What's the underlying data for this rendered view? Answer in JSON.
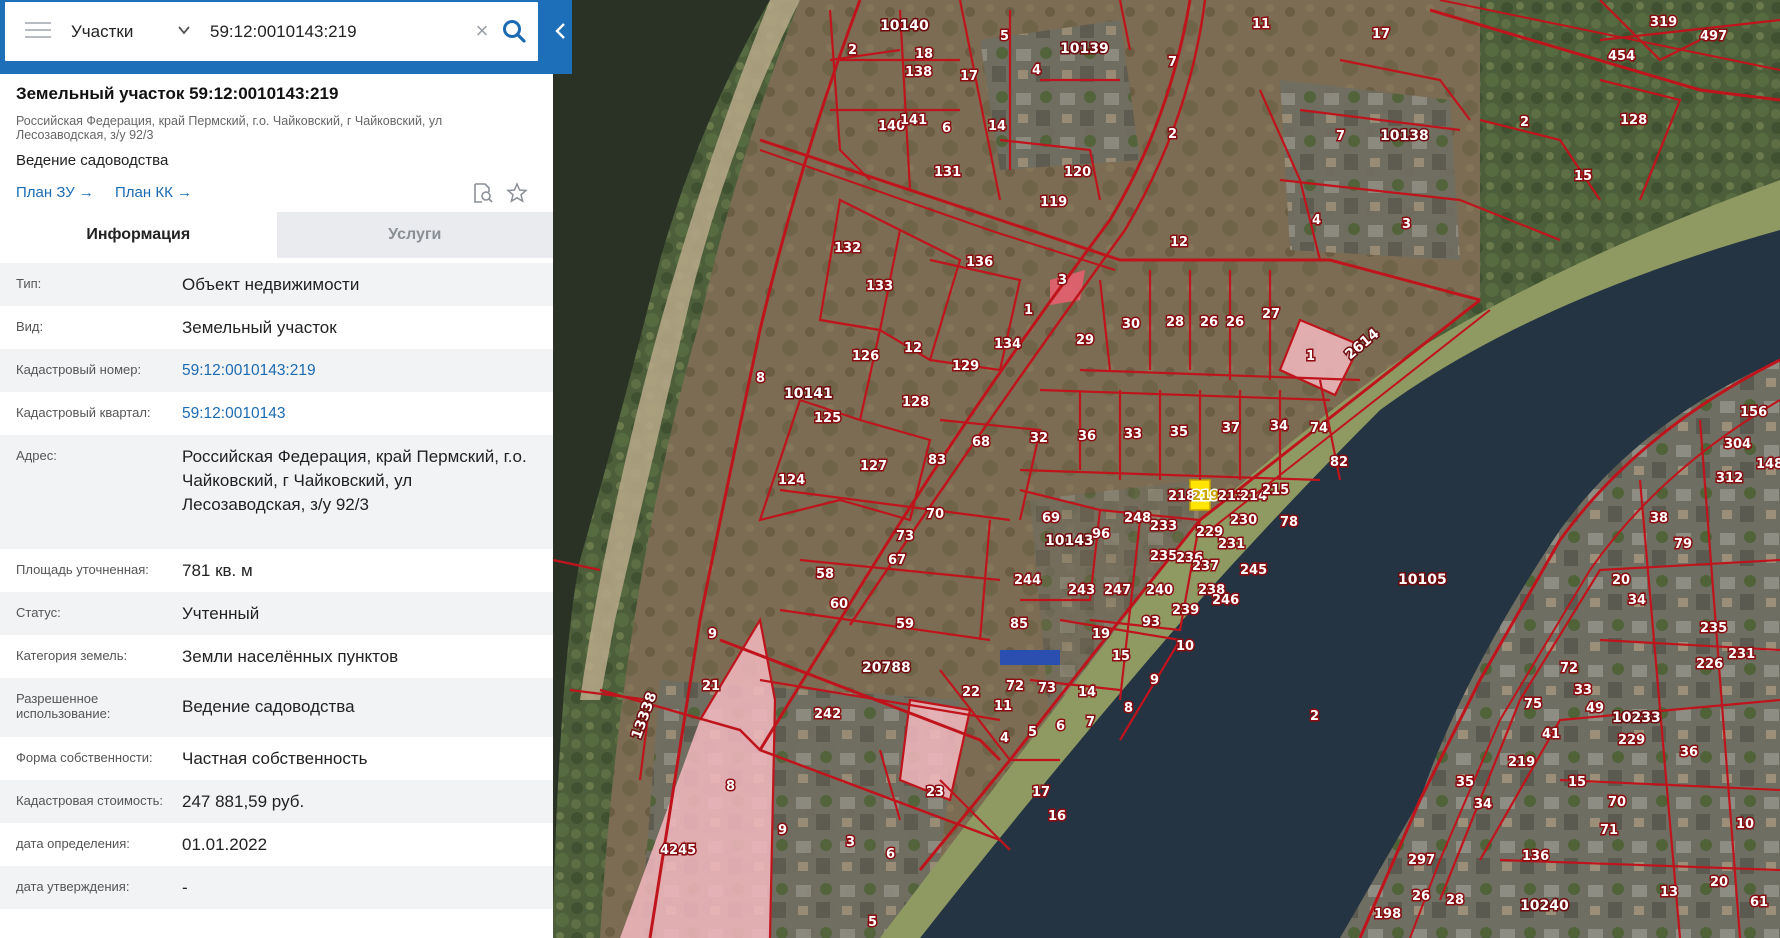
{
  "search": {
    "type_label": "Участки",
    "query": "59:12:0010143:219"
  },
  "card": {
    "title": "Земельный участок 59:12:0010143:219",
    "address": "Российская Федерация, край Пермский, г.о. Чайковский, г Чайковский, ул Лесозаводская, з/у 92/3",
    "use": "Ведение садоводства",
    "plan_zu": "План ЗУ →",
    "plan_kk": "План КК →"
  },
  "tabs": {
    "info": "Информация",
    "services": "Услуги"
  },
  "rows": [
    {
      "label": "Тип:",
      "value": "Объект недвижимости"
    },
    {
      "label": "Вид:",
      "value": "Земельный участок"
    },
    {
      "label": "Кадастровый номер:",
      "value": "59:12:0010143:219"
    },
    {
      "label": "Кадастровый квартал:",
      "value": "59:12:0010143"
    },
    {
      "label": "Адрес:",
      "value": "Российская Федерация, край Пермский, г.о. Чайковский, г Чайковский, ул Лесозаводская, з/у 92/3"
    },
    {
      "label": "Площадь уточненная:",
      "value": "781 кв. м"
    },
    {
      "label": "Статус:",
      "value": "Учтенный"
    },
    {
      "label": "Категория земель:",
      "value": "Земли населённых пунктов"
    },
    {
      "label": "Разрешенное использование:",
      "value": "Ведение садоводства"
    },
    {
      "label": "Форма собственности:",
      "value": "Частная собственность"
    },
    {
      "label": "Кадастровая стоимость:",
      "value": "247 881,59 руб."
    },
    {
      "label": "дата определения:",
      "value": "01.01.2022"
    },
    {
      "label": "дата утверждения:",
      "value": "-"
    }
  ],
  "map": {
    "quarters": [
      "10140",
      "10139",
      "10138",
      "10141",
      "10143",
      "10105",
      "10233",
      "10240",
      "20788",
      "13338",
      "2614"
    ],
    "plot_labels": [
      "2",
      "18",
      "138",
      "17",
      "5",
      "4",
      "7",
      "11",
      "17",
      "454",
      "319",
      "497",
      "140",
      "141",
      "6",
      "14",
      "131",
      "120",
      "119",
      "2",
      "7",
      "128",
      "15",
      "3",
      "4",
      "3",
      "12",
      "132",
      "136",
      "133",
      "3",
      "1",
      "30",
      "28",
      "26",
      "26",
      "27",
      "1",
      "8",
      "126",
      "12",
      "129",
      "134",
      "29",
      "128",
      "125",
      "32",
      "36",
      "33",
      "35",
      "37",
      "34",
      "74",
      "124",
      "127",
      "83",
      "68",
      "218",
      "219",
      "213",
      "214",
      "215",
      "82",
      "70",
      "69",
      "96",
      "248",
      "233",
      "230",
      "78",
      "73",
      "67",
      "58",
      "244",
      "235",
      "236",
      "229",
      "231",
      "60",
      "59",
      "243",
      "247",
      "240",
      "237",
      "238",
      "85",
      "19",
      "93",
      "239",
      "246",
      "245",
      "9",
      "15",
      "10",
      "21",
      "242",
      "72",
      "73",
      "22",
      "14",
      "11",
      "4",
      "5",
      "6",
      "7",
      "8",
      "17",
      "16",
      "23",
      "8",
      "9",
      "3",
      "6",
      "5",
      "4245",
      "156",
      "304",
      "312",
      "148",
      "38",
      "79",
      "20",
      "34",
      "235",
      "226",
      "231",
      "75",
      "72",
      "33",
      "49",
      "41",
      "219",
      "15",
      "70",
      "71",
      "10",
      "229",
      "36",
      "35",
      "34",
      "297",
      "26",
      "28",
      "198",
      "61",
      "10",
      "20",
      "136",
      "13"
    ],
    "highlighted_plot": "219",
    "river_label": "2"
  }
}
